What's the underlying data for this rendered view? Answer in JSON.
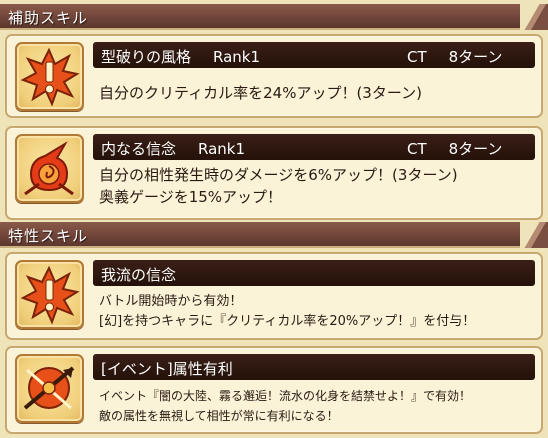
{
  "support_skills": {
    "header": "補助スキル",
    "skills": [
      {
        "name": "型破りの風格",
        "rank": "Rank1",
        "ct_label": "CT",
        "ct_turns": "8ターン",
        "description": [
          "自分のクリティカル率を24%アップ！(3ターン)"
        ],
        "icon": "critical-burst-icon"
      },
      {
        "name": "内なる信念",
        "rank": "Rank1",
        "ct_label": "CT",
        "ct_turns": "8ターン",
        "description": [
          "自分の相性発生時のダメージを6%アップ！(3ターン)",
          "奥義ゲージを15%アップ！"
        ],
        "icon": "flame-swirl-icon"
      }
    ]
  },
  "trait_skills": {
    "header": "特性スキル",
    "skills": [
      {
        "name": "我流の信念",
        "description": [
          "バトル開始時から有効！",
          "[幻]を持つキャラに『クリティカル率を20%アップ！』を付与！"
        ],
        "icon": "critical-burst-icon"
      },
      {
        "name": "[イベント]属性有利",
        "description": [
          "イベント『闇の大陸、霧る邂逅！流水の化身を結禁せよ！』で有効！",
          "敵の属性を無視して相性が常に有利になる！"
        ],
        "icon": "attribute-advantage-icon"
      }
    ]
  }
}
